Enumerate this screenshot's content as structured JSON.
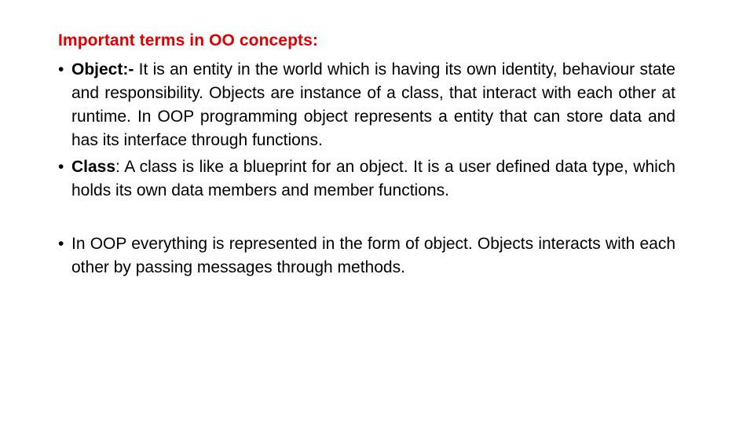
{
  "slide": {
    "title": "Important terms in OO concepts:",
    "accent_color": "#e00000",
    "bullets": [
      {
        "marker": "•",
        "term": "Object:-",
        "text": " It is an entity in the world which is having its own identity, behaviour state and responsibility. Objects are instance of a class, that interact with each other at runtime. In OOP programming object represents a entity that can store data and has its interface through functions."
      },
      {
        "marker": "•",
        "term": "Class",
        "text": ": A class is like a blueprint for an object. It is a user defined data type, which holds its own data members and member functions."
      },
      {
        "marker": "•",
        "term": "",
        "text": "In OOP everything is represented in the form of object. Objects interacts with each other by passing messages through methods."
      }
    ]
  }
}
